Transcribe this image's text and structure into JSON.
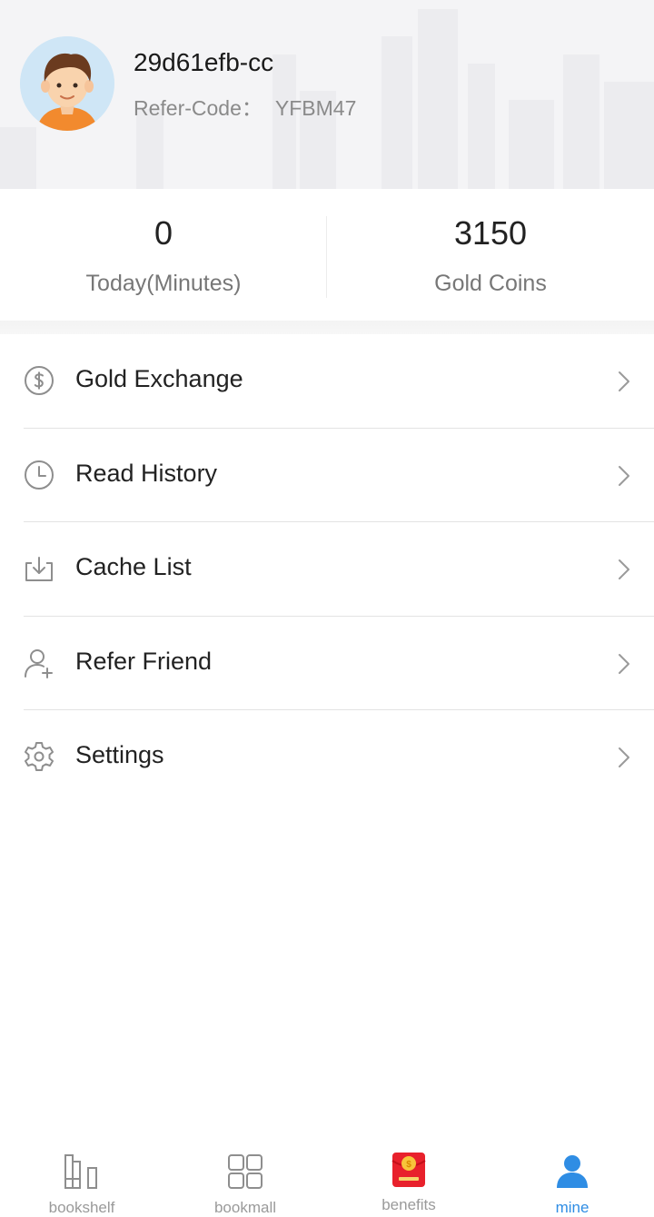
{
  "profile": {
    "username": "29d61efb-cc",
    "refer_code_label": "Refer-Code：",
    "refer_code": "YFBM47"
  },
  "stats": {
    "today": {
      "value": "0",
      "label": "Today(Minutes)"
    },
    "gold": {
      "value": "3150",
      "label": "Gold Coins"
    }
  },
  "menu": {
    "items": [
      {
        "label": "Gold Exchange",
        "icon": "dollar-coin-icon"
      },
      {
        "label": "Read History",
        "icon": "clock-icon"
      },
      {
        "label": "Cache List",
        "icon": "download-tray-icon"
      },
      {
        "label": "Refer Friend",
        "icon": "add-user-icon"
      },
      {
        "label": "Settings",
        "icon": "gear-icon"
      }
    ]
  },
  "tabbar": {
    "tabs": [
      {
        "label": "bookshelf",
        "icon": "bookshelf-icon"
      },
      {
        "label": "bookmall",
        "icon": "grid-icon"
      },
      {
        "label": "benefits",
        "icon": "red-envelope-icon"
      },
      {
        "label": "mine",
        "icon": "person-icon"
      }
    ],
    "active": "mine"
  },
  "colors": {
    "accent": "#2f8de4",
    "text": "#222222",
    "muted": "#8a8a8a",
    "divider": "#e3e3e3",
    "header_bg": "#f4f4f6",
    "envelope_red": "#e8212c"
  }
}
